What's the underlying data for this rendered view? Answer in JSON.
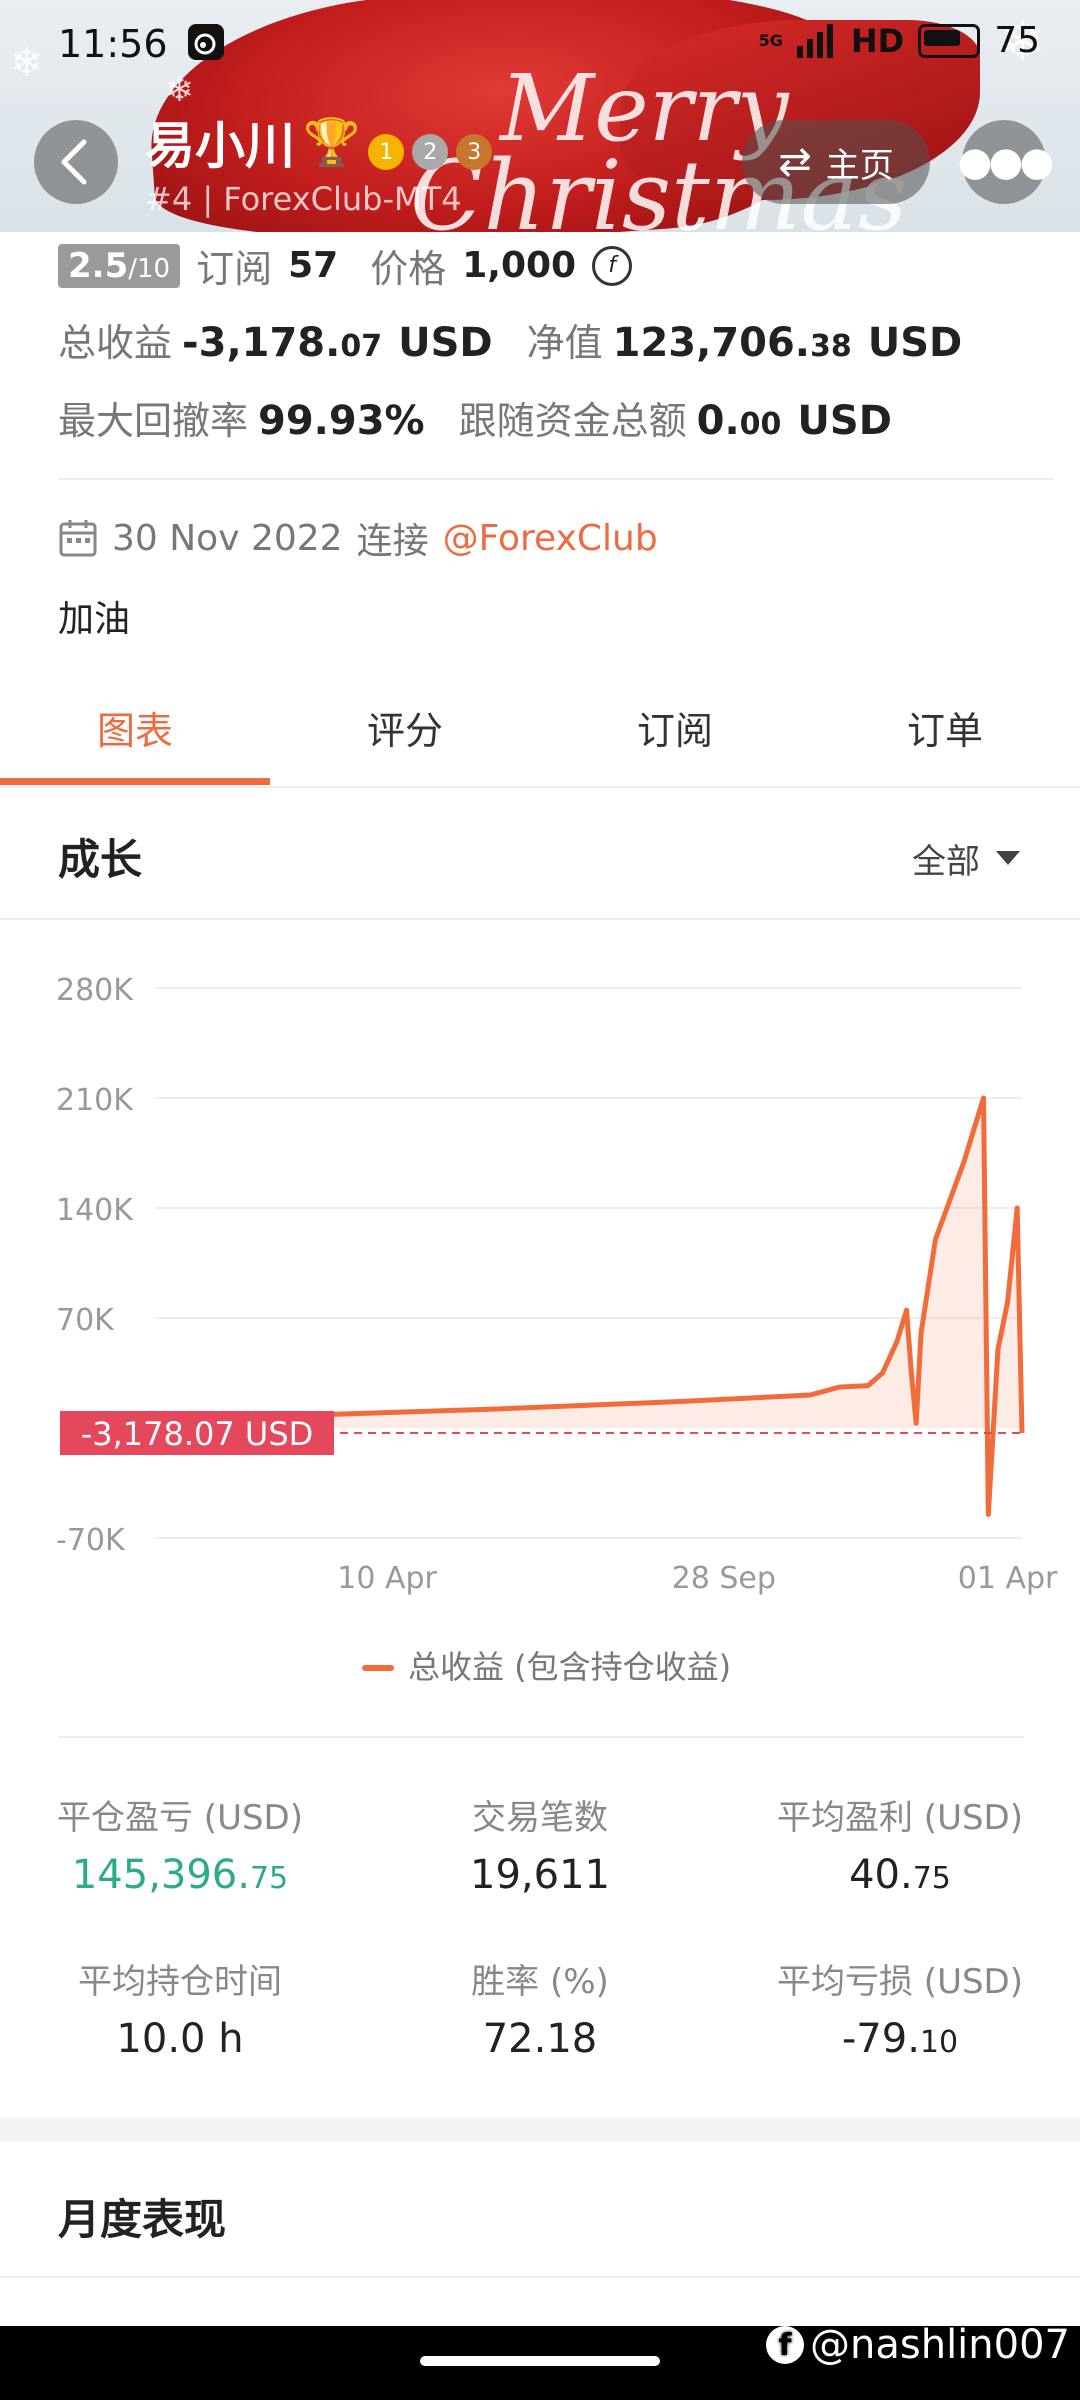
{
  "status_bar": {
    "time": "11:56",
    "network": "5G",
    "hd": "HD",
    "battery": "75"
  },
  "header": {
    "name": "易小川",
    "subtitle": "#4 | ForexClub-MT4",
    "home_label": "主页",
    "banner_text_1": "Merry",
    "banner_text_2": "Christmas",
    "medals": [
      "1",
      "2",
      "3"
    ]
  },
  "summary": {
    "rating": "2.5",
    "rating_max": "/10",
    "subscribe_label": "订阅",
    "subscribe_count": "57",
    "price_label": "价格",
    "price_value": "1,000",
    "total_profit_label": "总收益",
    "total_profit_main": "-3,178.",
    "total_profit_dec": "07",
    "total_profit_unit": "USD",
    "equity_label": "净值",
    "equity_main": "123,706.",
    "equity_dec": "38",
    "equity_unit": "USD",
    "drawdown_label": "最大回撤率",
    "drawdown_value": "99.93%",
    "follow_label": "跟随资金总额",
    "follow_main": "0.",
    "follow_dec": "00",
    "follow_unit": "USD"
  },
  "connection": {
    "date": "30 Nov 2022",
    "label": "连接",
    "broker": "@ForexClub"
  },
  "motto": "加油",
  "tabs": [
    "图表",
    "评分",
    "订阅",
    "订单"
  ],
  "growth": {
    "title": "成长",
    "filter": "全部"
  },
  "chart_data": {
    "type": "area",
    "y_ticks": [
      "280K",
      "210K",
      "140K",
      "70K",
      "-70K"
    ],
    "x_ticks": [
      "10 Apr",
      "28 Sep",
      "01 Apr"
    ],
    "ylim": [
      -70000,
      280000
    ],
    "current_label": "-3,178.07 USD",
    "legend": "总收益 (包含持仓收益)",
    "color": "#f26b3a",
    "series": [
      {
        "name": "总收益 (包含持仓收益)",
        "points": [
          [
            0.0,
            0
          ],
          [
            0.1,
            4000
          ],
          [
            0.25,
            8000
          ],
          [
            0.45,
            12000
          ],
          [
            0.65,
            17000
          ],
          [
            0.78,
            21000
          ],
          [
            0.81,
            26000
          ],
          [
            0.84,
            27000
          ],
          [
            0.855,
            35000
          ],
          [
            0.87,
            55000
          ],
          [
            0.88,
            75000
          ],
          [
            0.885,
            35000
          ],
          [
            0.89,
            3000
          ],
          [
            0.895,
            60000
          ],
          [
            0.91,
            120000
          ],
          [
            0.94,
            170000
          ],
          [
            0.955,
            200000
          ],
          [
            0.96,
            210000
          ],
          [
            0.965,
            -55000
          ],
          [
            0.975,
            50000
          ],
          [
            0.985,
            80000
          ],
          [
            0.995,
            140000
          ],
          [
            1.0,
            -3178
          ]
        ]
      }
    ]
  },
  "stats": [
    {
      "label": "平仓盈亏 (USD)",
      "main": "145,396.",
      "dec": "75",
      "color": "#2bab8c"
    },
    {
      "label": "交易笔数",
      "main": "19,611",
      "dec": "",
      "color": "#222"
    },
    {
      "label": "平均盈利 (USD)",
      "main": "40.",
      "dec": "75",
      "color": "#222"
    },
    {
      "label": "平均持仓时间",
      "main": "10.0 h",
      "dec": "",
      "color": "#222"
    },
    {
      "label": "胜率 (%)",
      "main": "72.18",
      "dec": "",
      "color": "#222"
    },
    {
      "label": "平均亏损 (USD)",
      "main": "-79.",
      "dec": "10",
      "color": "#222"
    }
  ],
  "monthly": {
    "title": "月度表现"
  },
  "watermark": "@nashlin007"
}
